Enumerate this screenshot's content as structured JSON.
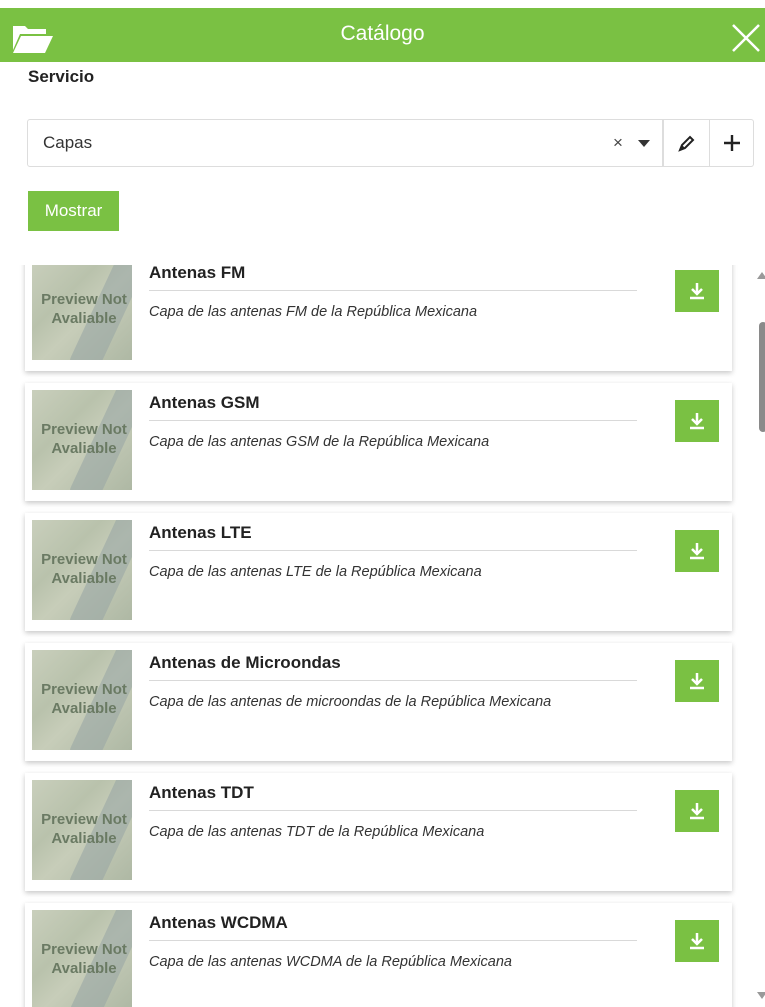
{
  "header": {
    "title": "Catálogo",
    "left_icon": "folder-open-icon",
    "right_icon": "close-icon",
    "color": "#7ac143"
  },
  "service": {
    "label": "Servicio",
    "select_value": "Capas",
    "clear_glyph": "×",
    "edit_icon": "pencil-icon",
    "add_icon": "plus-icon"
  },
  "show_button": "Mostrar",
  "thumbnail_text": {
    "line1": "Preview Not",
    "line2": "Avaliable"
  },
  "items": [
    {
      "title": "Antenas FM",
      "description": "Capa de las antenas FM de la República Mexicana"
    },
    {
      "title": "Antenas GSM",
      "description": "Capa de las antenas GSM de la República Mexicana"
    },
    {
      "title": "Antenas LTE",
      "description": "Capa de las antenas LTE de la República Mexicana"
    },
    {
      "title": "Antenas de Microondas",
      "description": "Capa de las antenas de microondas de la República Mexicana"
    },
    {
      "title": "Antenas TDT",
      "description": "Capa de las antenas TDT de la República Mexicana"
    },
    {
      "title": "Antenas WCDMA",
      "description": "Capa de las antenas WCDMA de la República Mexicana"
    }
  ]
}
